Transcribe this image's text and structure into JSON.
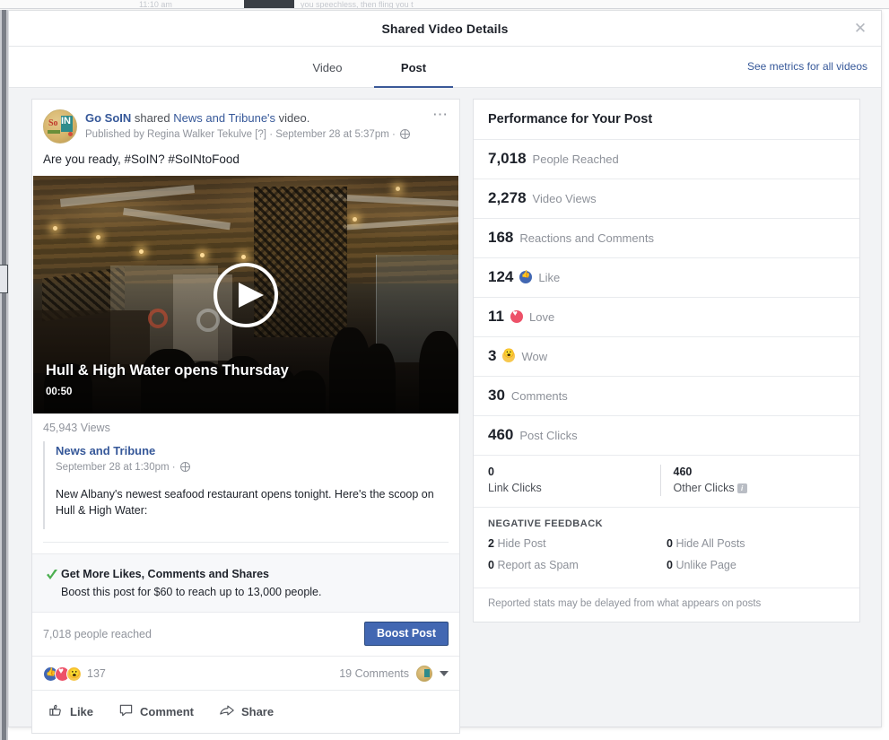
{
  "background_strip": {
    "left_text": "11:10 am",
    "right_text": "you speechless, then fling you t"
  },
  "modal": {
    "title": "Shared Video Details",
    "close_icon": "close-icon"
  },
  "tabs": [
    {
      "label": "Video",
      "active": false
    },
    {
      "label": "Post",
      "active": true
    }
  ],
  "see_metrics_link": "See metrics for all videos",
  "post": {
    "author": "Go SoIN",
    "shared_text": " shared ",
    "shared_page": "News and Tribune's",
    "shared_suffix": " video.",
    "published_by": "Published by Regina Walker Tekulve [?] · September 28 at 5:37pm · ",
    "message": "Are you ready, #SoIN? #SoINtoFood",
    "menu_icon": "ellipsis-icon",
    "privacy_icon": "globe-icon",
    "video": {
      "title": "Hull & High Water opens Thursday",
      "duration": "00:50",
      "play_icon": "play-icon"
    },
    "views": "45,943 Views",
    "shared_article": {
      "source": "News and Tribune",
      "meta": "September 28 at 1:30pm · ",
      "text": "New Albany's newest seafood restaurant opens tonight. Here's the scoop on Hull & High Water:"
    },
    "boost": {
      "check_icon": "green-check-icon",
      "headline": "Get More Likes, Comments and Shares",
      "subline": "Boost this post for $60 to reach up to 13,000 people.",
      "reach_text": "7,018 people reached",
      "button_label": "Boost Post"
    },
    "reactions": {
      "icons": [
        "like-icon",
        "love-icon",
        "wow-icon"
      ],
      "count": "137",
      "comments_label": "19 Comments",
      "avatar": "commenter-avatar",
      "caret_icon": "caret-down-icon"
    },
    "actions": [
      {
        "label": "Like",
        "icon": "thumbs-up-icon"
      },
      {
        "label": "Comment",
        "icon": "comment-bubble-icon"
      },
      {
        "label": "Share",
        "icon": "share-arrow-icon"
      }
    ]
  },
  "performance": {
    "title": "Performance for Your Post",
    "rows": [
      {
        "value": "7,018",
        "label": "People Reached",
        "icon": null,
        "grey": true
      },
      {
        "value": "2,278",
        "label": "Video Views",
        "icon": null,
        "grey": true
      },
      {
        "value": "168",
        "label": "Reactions and Comments",
        "icon": null,
        "grey": true
      },
      {
        "value": "124",
        "label": "Like",
        "icon": "like-icon",
        "grey": true
      },
      {
        "value": "11",
        "label": "Love",
        "icon": "love-icon",
        "grey": true
      },
      {
        "value": "3",
        "label": "Wow",
        "icon": "wow-icon",
        "grey": true
      },
      {
        "value": "30",
        "label": "Comments",
        "icon": null,
        "grey": true
      },
      {
        "value": "460",
        "label": "Post Clicks",
        "icon": null,
        "grey": true
      }
    ],
    "clicks": {
      "link_clicks_value": "0",
      "link_clicks_label": "Link Clicks",
      "other_clicks_value": "460",
      "other_clicks_label": "Other Clicks",
      "info_icon": "info-icon"
    },
    "negative_feedback": {
      "heading": "NEGATIVE FEEDBACK",
      "items": [
        {
          "value": "2",
          "label": "Hide Post"
        },
        {
          "value": "0",
          "label": "Hide All Posts"
        },
        {
          "value": "0",
          "label": "Report as Spam"
        },
        {
          "value": "0",
          "label": "Unlike Page"
        }
      ]
    },
    "footnote": "Reported stats may be delayed from what appears on posts"
  },
  "colors": {
    "brand_blue": "#3b5998",
    "button_blue": "#4267b2",
    "link_blue": "#365899",
    "like_blue": "#4267b2",
    "love_red": "#ed5168",
    "wow_yellow": "#f7c84e",
    "check_green": "#42b72a"
  }
}
